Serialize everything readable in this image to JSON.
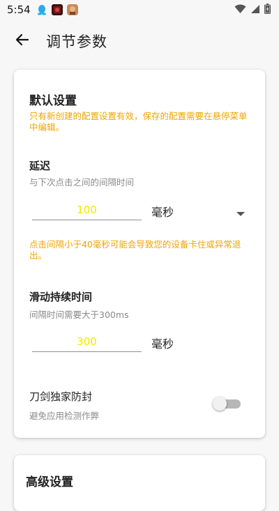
{
  "status_bar": {
    "time": "5:54"
  },
  "app_bar": {
    "title": "调节参数"
  },
  "default_settings": {
    "title": "默认设置",
    "warning": "只有新创建的配置设置有效，保存的配置需要在悬停菜单中编辑。",
    "delay": {
      "label": "延迟",
      "hint": "与下次点击之间的间隔时间",
      "value": "100",
      "unit": "毫秒",
      "warning": "点击间隔小于40毫秒可能会导致您的设备卡住或异常退出。"
    },
    "swipe_duration": {
      "label": "滑动持续时间",
      "hint": "间隔时间需要大于300ms",
      "value": "300",
      "unit": "毫秒"
    },
    "anti_ban": {
      "label": "刀剑独家防封",
      "hint": "避免应用检测作弊",
      "enabled": false
    }
  },
  "advanced_settings": {
    "title": "高级设置"
  },
  "colors": {
    "warning": "#f0a500",
    "input_value": "#f5e600",
    "hint": "#8a8a8a"
  }
}
